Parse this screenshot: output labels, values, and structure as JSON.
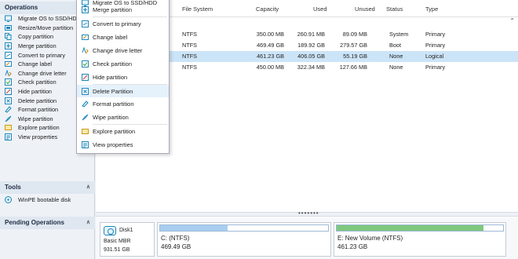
{
  "left_panel": {
    "operations_title": "Operations",
    "operations": [
      {
        "label": "Migrate OS to SSD/HDD",
        "icon": "migrate-os-icon"
      },
      {
        "label": "Resize/Move partition",
        "icon": "resize-partition-icon"
      },
      {
        "label": "Copy partition",
        "icon": "copy-partition-icon"
      },
      {
        "label": "Merge partition",
        "icon": "merge-partition-icon"
      },
      {
        "label": "Convert to primary",
        "icon": "convert-primary-icon"
      },
      {
        "label": "Change label",
        "icon": "change-label-icon"
      },
      {
        "label": "Change drive letter",
        "icon": "change-drive-letter-icon"
      },
      {
        "label": "Check partition",
        "icon": "check-partition-icon"
      },
      {
        "label": "Hide partition",
        "icon": "hide-partition-icon"
      },
      {
        "label": "Delete partition",
        "icon": "delete-partition-icon"
      },
      {
        "label": "Format partition",
        "icon": "format-partition-icon"
      },
      {
        "label": "Wipe partition",
        "icon": "wipe-partition-icon"
      },
      {
        "label": "Explore partition",
        "icon": "explore-partition-icon"
      },
      {
        "label": "View properties",
        "icon": "view-properties-icon"
      }
    ],
    "tools_title": "Tools",
    "tools": [
      {
        "label": "WinPE bootable disk",
        "icon": "winpe-disk-icon"
      }
    ],
    "pending_title": "Pending Operations"
  },
  "table": {
    "columns": [
      "File System",
      "Capacity",
      "Used",
      "Unused",
      "Status",
      "Type"
    ],
    "rows": [
      {
        "fs": "NTFS",
        "capacity": "350.00 MB",
        "used": "260.91 MB",
        "unused": "89.09 MB",
        "status": "System",
        "type": "Primary",
        "selected": false
      },
      {
        "fs": "NTFS",
        "capacity": "469.49 GB",
        "used": "189.92 GB",
        "unused": "279.57 GB",
        "status": "Boot",
        "type": "Primary",
        "selected": false
      },
      {
        "fs": "NTFS",
        "capacity": "461.23 GB",
        "used": "406.05 GB",
        "unused": "55.19 GB",
        "status": "None",
        "type": "Logical",
        "selected": true
      },
      {
        "fs": "NTFS",
        "capacity": "450.00 MB",
        "used": "322.34 MB",
        "unused": "127.66 MB",
        "status": "None",
        "type": "Primary",
        "selected": false
      }
    ]
  },
  "context_menu": {
    "items": [
      {
        "label": "Migrate OS to SSD/HDD",
        "icon": "migrate-os-icon"
      },
      {
        "label": "Merge partition",
        "icon": "merge-partition-icon"
      },
      {
        "label": "Convert to primary",
        "icon": "convert-primary-icon"
      },
      {
        "label": "Change label",
        "icon": "change-label-icon"
      },
      {
        "label": "Change drive letter",
        "icon": "change-drive-letter-icon"
      },
      {
        "label": "Check partition",
        "icon": "check-partition-icon"
      },
      {
        "label": "Hide partition",
        "icon": "hide-partition-icon"
      },
      {
        "label": "Delete Partition",
        "icon": "delete-partition-icon",
        "highlighted": true
      },
      {
        "label": "Format partition",
        "icon": "format-partition-icon"
      },
      {
        "label": "Wipe partition",
        "icon": "wipe-partition-icon"
      },
      {
        "label": "Explore partition",
        "icon": "explore-partition-icon"
      },
      {
        "label": "View properties",
        "icon": "view-properties-icon"
      }
    ]
  },
  "disk_map": {
    "disk_name": "Disk1",
    "disk_type": "Basic MBR",
    "disk_size": "931.51 GB",
    "partitions": [
      {
        "label": "C: (NTFS)",
        "size": "469.49 GB",
        "used_fraction": 0.4,
        "fill_color": "#a9cdf0"
      },
      {
        "label": "E: New Volume (NTFS)",
        "size": "461.23 GB",
        "used_fraction": 0.88,
        "fill_color": "#7ec87e"
      }
    ]
  },
  "colors": {
    "accent": "#1d86b8",
    "selection": "#cce4f7",
    "menu_highlight": "#e5f1fb"
  }
}
